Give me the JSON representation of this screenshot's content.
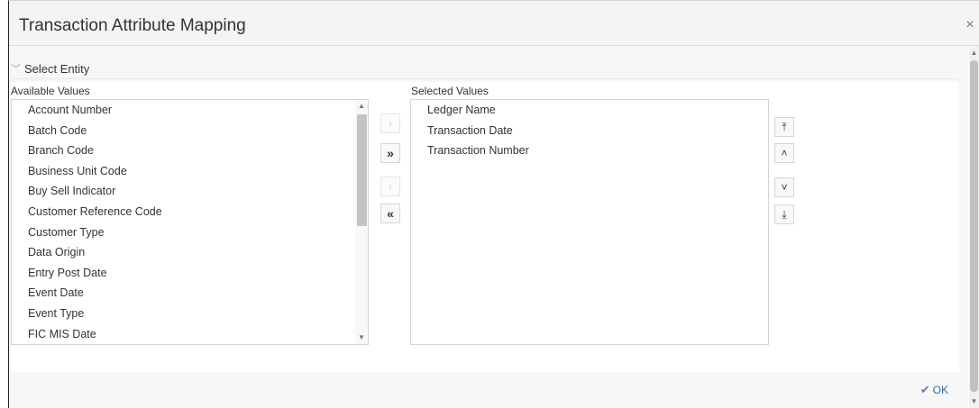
{
  "dialog": {
    "title": "Transaction Attribute Mapping",
    "close_icon": "×"
  },
  "section": {
    "label": "Select Entity",
    "chevron": "﹀"
  },
  "available": {
    "label": "Available Values",
    "items": [
      "Account Number",
      "Batch Code",
      "Branch Code",
      "Business Unit Code",
      "Buy Sell Indicator",
      "Customer Reference Code",
      "Customer Type",
      "Data Origin",
      "Entry Post Date",
      "Event Date",
      "Event Type",
      "FIC MIS Date"
    ]
  },
  "selected": {
    "label": "Selected Values",
    "items": [
      "Ledger Name",
      "Transaction Date",
      "Transaction Number"
    ]
  },
  "move_buttons": {
    "move_right": "›",
    "move_all_right": "»",
    "move_left": "‹",
    "move_all_left": "«"
  },
  "order_buttons": {
    "move_top": "⤒",
    "move_up": "˄",
    "move_down": "˅",
    "move_bottom": "⤓"
  },
  "footer": {
    "ok_label": "OK",
    "check_icon": "✔"
  }
}
